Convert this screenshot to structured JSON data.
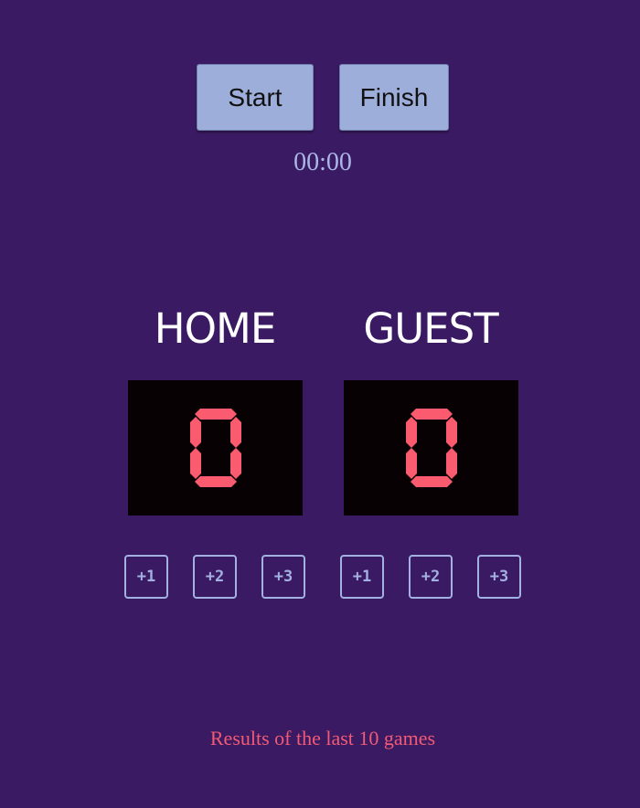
{
  "controls": {
    "start_label": "Start",
    "finish_label": "Finish"
  },
  "timer": "00:00",
  "home": {
    "label": "HOME",
    "score": "0",
    "buttons": [
      "+1",
      "+2",
      "+3"
    ]
  },
  "guest": {
    "label": "GUEST",
    "score": "0",
    "buttons": [
      "+1",
      "+2",
      "+3"
    ]
  },
  "results": {
    "title": "Results of the last 10 games"
  },
  "colors": {
    "background": "#3a1a62",
    "button": "#9eaedb",
    "score_digit": "#fa5b6f",
    "score_panel": "#080104",
    "accent": "#a2b0e2",
    "results_text": "#f25a75"
  }
}
